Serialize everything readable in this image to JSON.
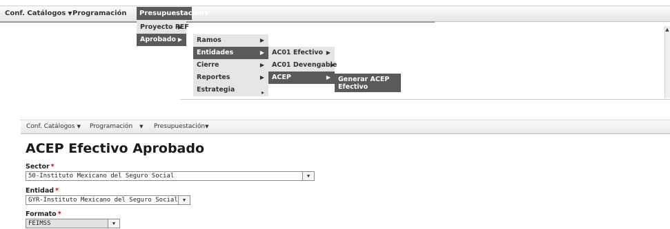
{
  "top_menu": {
    "items": [
      {
        "label": "Conf. Catálogos",
        "arrow": "▼"
      },
      {
        "label": "Programación",
        "arrow": "▼"
      },
      {
        "label": "Presupuestación",
        "arrow": "▼"
      }
    ]
  },
  "dropdown_level1": {
    "items": [
      {
        "label": "Proyecto PEF",
        "arrow": "▶"
      },
      {
        "label": "Aprobado",
        "arrow": "▶"
      }
    ]
  },
  "dropdown_level2": {
    "items": [
      {
        "label": "Ramos",
        "arrow": "▶"
      },
      {
        "label": "Entidades",
        "arrow": "▶"
      },
      {
        "label": "Cierre",
        "arrow": "▶"
      },
      {
        "label": "Reportes",
        "arrow": "▶"
      },
      {
        "label": "Estrategia",
        "arrow": "▸"
      }
    ]
  },
  "dropdown_level3": {
    "items": [
      {
        "label": "AC01 Efectivo",
        "arrow": "▶"
      },
      {
        "label": "AC01 Devengable",
        "arrow": "▶"
      },
      {
        "label": "ACEP",
        "arrow": "▶"
      }
    ]
  },
  "dropdown_level4": {
    "line1": "Generar ACEP",
    "line2": "Efectivo"
  },
  "scroll_up_arrow": "▲",
  "second_menu": {
    "items": [
      {
        "label": "Conf. Catálogos",
        "arrow": "▼"
      },
      {
        "label": "Programación",
        "arrow": "▼"
      },
      {
        "label": "Presupuestación",
        "arrow": "▼"
      }
    ]
  },
  "page": {
    "title": "ACEP Efectivo Aprobado"
  },
  "form": {
    "sector": {
      "label": "Sector",
      "required_mark": "*",
      "value": "50-Instituto Mexicano del Seguro Social",
      "arrow": "▼"
    },
    "entidad": {
      "label": "Entidad",
      "required_mark": "*",
      "value": "GYR-Instituto Mexicano del Seguro Social",
      "arrow": "▼"
    },
    "formato": {
      "label": "Formato",
      "required_mark": "*",
      "value": "FEIMSS",
      "arrow": "▼"
    }
  }
}
